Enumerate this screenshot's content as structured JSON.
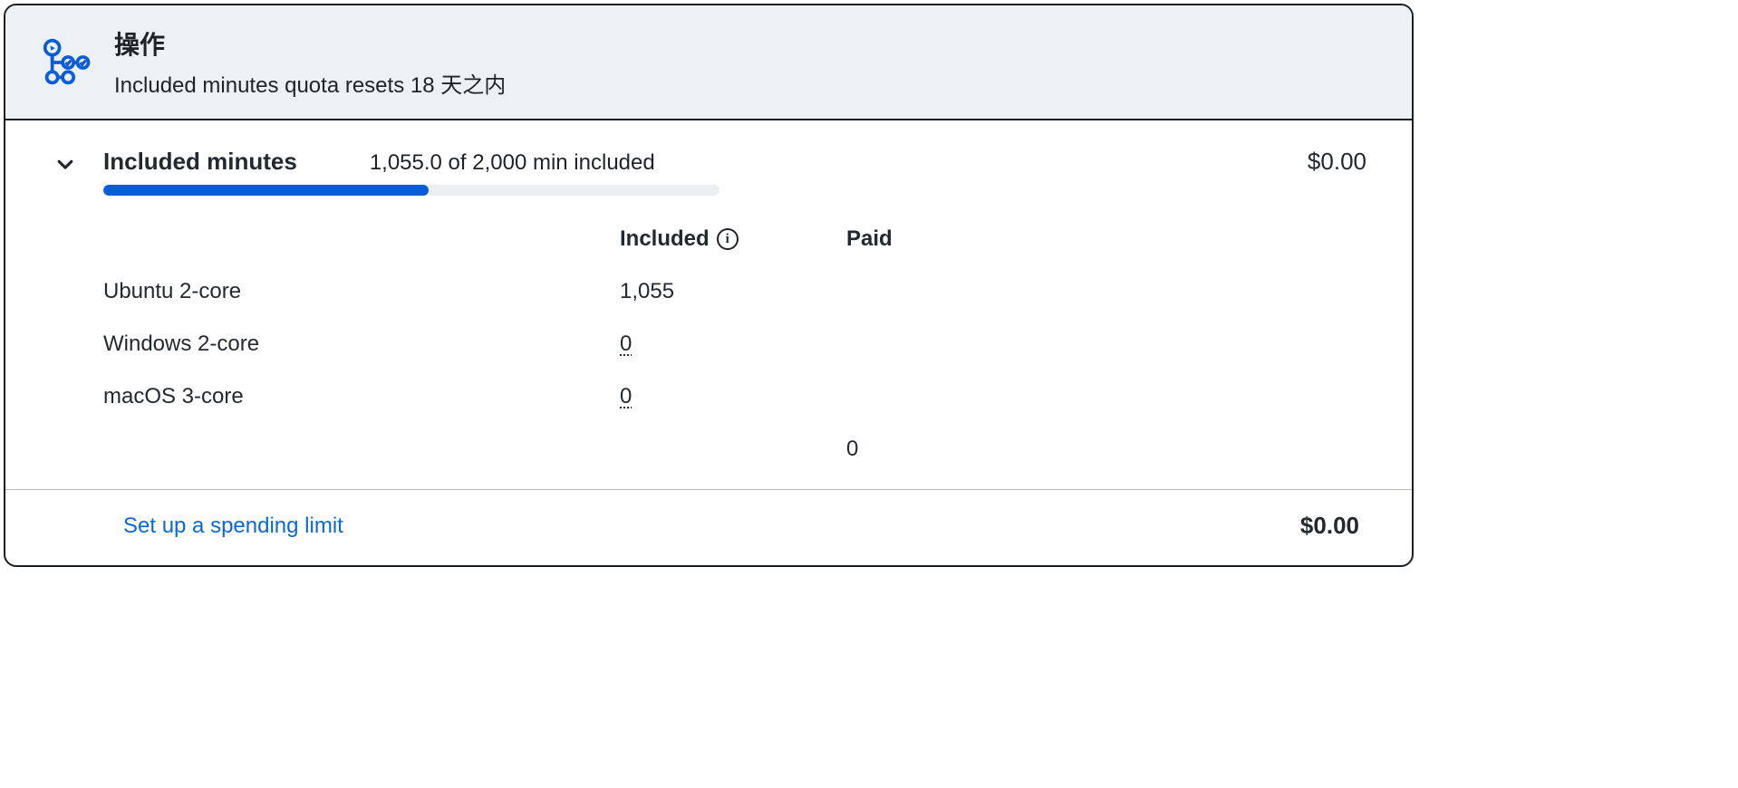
{
  "header": {
    "title": "操作",
    "subtitle": "Included minutes quota resets 18 天之内"
  },
  "summary": {
    "title": "Included minutes",
    "usage_text": "1,055.0 of 2,000 min included",
    "used": 1055,
    "total": 2000,
    "progress_percent": 52.75,
    "price": "$0.00"
  },
  "columns": {
    "included": "Included",
    "paid": "Paid"
  },
  "rows": [
    {
      "name": "Ubuntu 2-core",
      "included": "1,055",
      "uline": false,
      "paid": ""
    },
    {
      "name": "Windows 2-core",
      "included": "0",
      "uline": true,
      "paid": ""
    },
    {
      "name": "macOS 3-core",
      "included": "0",
      "uline": true,
      "paid": ""
    }
  ],
  "paid_total": "0",
  "footer": {
    "link": "Set up a spending limit",
    "total": "$0.00"
  },
  "colors": {
    "accent": "#0b5cd7",
    "link": "#0969da"
  }
}
